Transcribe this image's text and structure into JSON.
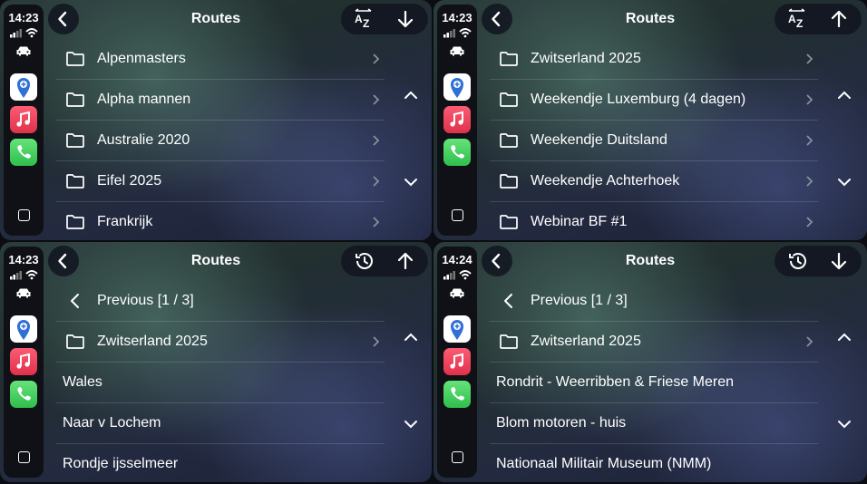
{
  "colors": {
    "accent": "#4a90e2",
    "music": "#f2435a",
    "phone": "#3ccf57"
  },
  "icons": {
    "back": "chevron-left-icon",
    "sort_az": "sort-az-icon",
    "history": "history-icon",
    "arrow_up": "arrow-up-icon",
    "arrow_down": "arrow-down-icon",
    "folder": "folder-icon",
    "row_chevron": "chevron-right-icon",
    "scroll_up": "chevron-up-icon",
    "scroll_down": "chevron-down-icon"
  },
  "panels": [
    {
      "time": "14:23",
      "title": "Routes",
      "actions": [
        "sort-az",
        "arrow-down"
      ],
      "items": [
        {
          "type": "folder",
          "label": "Alpenmasters"
        },
        {
          "type": "folder",
          "label": "Alpha mannen"
        },
        {
          "type": "folder",
          "label": "Australie 2020"
        },
        {
          "type": "folder",
          "label": "Eifel 2025"
        },
        {
          "type": "folder",
          "label": "Frankrijk"
        }
      ]
    },
    {
      "time": "14:23",
      "title": "Routes",
      "actions": [
        "sort-az",
        "arrow-up"
      ],
      "items": [
        {
          "type": "folder",
          "label": "Zwitserland 2025"
        },
        {
          "type": "folder",
          "label": "Weekendje Luxemburg (4 dagen)"
        },
        {
          "type": "folder",
          "label": "Weekendje Duitsland"
        },
        {
          "type": "folder",
          "label": "Weekendje Achterhoek"
        },
        {
          "type": "folder",
          "label": "Webinar BF #1"
        }
      ]
    },
    {
      "time": "14:23",
      "title": "Routes",
      "actions": [
        "history",
        "arrow-up"
      ],
      "items": [
        {
          "type": "prev",
          "label": "Previous [1 / 3]"
        },
        {
          "type": "folder",
          "label": "Zwitserland 2025"
        },
        {
          "type": "plain",
          "label": "Wales"
        },
        {
          "type": "plain",
          "label": "Naar v Lochem"
        },
        {
          "type": "plain",
          "label": "Rondje ijsselmeer"
        }
      ]
    },
    {
      "time": "14:24",
      "title": "Routes",
      "actions": [
        "history",
        "arrow-down"
      ],
      "items": [
        {
          "type": "prev",
          "label": "Previous [1 / 3]"
        },
        {
          "type": "folder",
          "label": "Zwitserland 2025"
        },
        {
          "type": "plain",
          "label": "Rondrit - Weerribben & Friese Meren"
        },
        {
          "type": "plain",
          "label": "Blom motoren - huis"
        },
        {
          "type": "plain",
          "label": "Nationaal Militair Museum (NMM)"
        }
      ]
    }
  ]
}
